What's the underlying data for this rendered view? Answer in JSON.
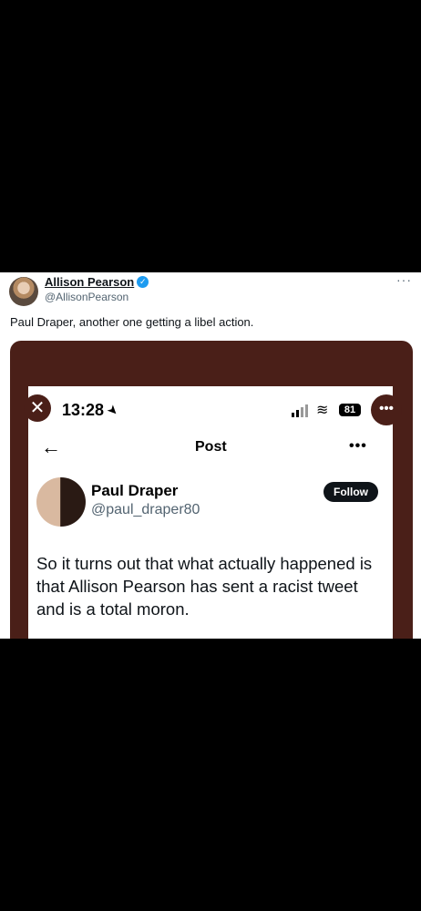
{
  "tweet": {
    "author_name": "Allison Pearson",
    "author_handle": "@AllisonPearson",
    "more_label": "···",
    "text": "Paul Draper, another one getting a libel action."
  },
  "screenshot": {
    "status_time": "13:28",
    "battery": "81",
    "nav_title": "Post",
    "more_label": "•••",
    "author_name": "Paul Draper",
    "author_handle": "@paul_draper80",
    "follow_label": "Follow",
    "text": "So it turns out that what actually happened is that Allison Pearson has sent a racist tweet and is a total moron."
  },
  "icons": {
    "close": "close-icon",
    "more": "more-icon",
    "back": "back-arrow-icon",
    "verified": "verified-badge-icon",
    "location": "location-arrow-icon",
    "signal": "signal-icon",
    "wifi": "wifi-icon",
    "battery": "battery-icon"
  },
  "colors": {
    "background": "#000000",
    "media_frame": "#4a1f18",
    "verified": "#1d9bf0",
    "follow_button": "#0f1419"
  }
}
